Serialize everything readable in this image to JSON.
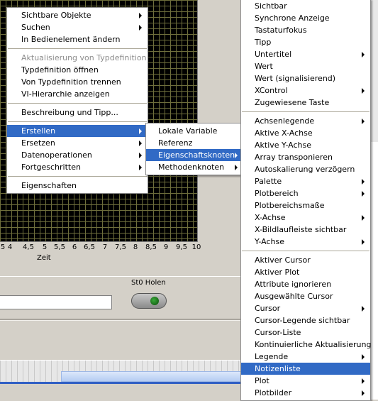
{
  "plot": {
    "x_ticks": [
      "5",
      "4",
      "4,5",
      "5",
      "5,5",
      "6",
      "6,5",
      "7",
      "7,5",
      "8",
      "8,5",
      "9",
      "9,5",
      "10"
    ],
    "x_label": "Zeit"
  },
  "button": {
    "label": "St0 Holen"
  },
  "menu_main": {
    "items": [
      {
        "label": "Sichtbare Objekte",
        "submenu": true
      },
      {
        "label": "Suchen",
        "submenu": true
      },
      {
        "label": "In Bedienelement ändern"
      },
      {
        "sep": true
      },
      {
        "label": "Aktualisierung von Typdefinition",
        "disabled": true
      },
      {
        "label": "Typdefinition öffnen"
      },
      {
        "label": "Von Typdefinition trennen"
      },
      {
        "label": "VI-Hierarchie anzeigen"
      },
      {
        "sep": true
      },
      {
        "label": "Beschreibung und Tipp..."
      },
      {
        "sep": true
      },
      {
        "label": "Erstellen",
        "submenu": true,
        "highlighted": true
      },
      {
        "label": "Ersetzen",
        "submenu": true
      },
      {
        "label": "Datenoperationen",
        "submenu": true
      },
      {
        "label": "Fortgeschritten",
        "submenu": true
      },
      {
        "sep": true
      },
      {
        "label": "Eigenschaften"
      }
    ]
  },
  "menu_create": {
    "items": [
      {
        "label": "Lokale Variable"
      },
      {
        "label": "Referenz"
      },
      {
        "label": "Eigenschaftsknoten",
        "submenu": true,
        "highlighted": true
      },
      {
        "label": "Methodenknoten",
        "submenu": true
      }
    ]
  },
  "menu_props": {
    "items": [
      {
        "label": "Sichtbar"
      },
      {
        "label": "Synchrone Anzeige"
      },
      {
        "label": "Tastaturfokus"
      },
      {
        "label": "Tipp"
      },
      {
        "label": "Untertitel",
        "submenu": true
      },
      {
        "label": "Wert"
      },
      {
        "label": "Wert (signalisierend)"
      },
      {
        "label": "XControl",
        "submenu": true
      },
      {
        "label": "Zugewiesene Taste"
      },
      {
        "sep": true
      },
      {
        "label": "Achsenlegende",
        "submenu": true
      },
      {
        "label": "Aktive X-Achse"
      },
      {
        "label": "Aktive Y-Achse"
      },
      {
        "label": "Array transponieren"
      },
      {
        "label": "Autoskalierung verzögern"
      },
      {
        "label": "Palette",
        "submenu": true
      },
      {
        "label": "Plotbereich",
        "submenu": true
      },
      {
        "label": "Plotbereichsmaße"
      },
      {
        "label": "X-Achse",
        "submenu": true
      },
      {
        "label": "X-Bildlaufleiste sichtbar"
      },
      {
        "label": "Y-Achse",
        "submenu": true
      },
      {
        "sep": true
      },
      {
        "label": "Aktiver Cursor"
      },
      {
        "label": "Aktiver Plot"
      },
      {
        "label": "Attribute ignorieren"
      },
      {
        "label": "Ausgewählte Cursor"
      },
      {
        "label": "Cursor",
        "submenu": true
      },
      {
        "label": "Cursor-Legende sichtbar"
      },
      {
        "label": "Cursor-Liste"
      },
      {
        "label": "Kontinuierliche Aktualisierung"
      },
      {
        "label": "Legende",
        "submenu": true
      },
      {
        "label": "Notizenliste",
        "highlighted": true
      },
      {
        "label": "Plot",
        "submenu": true
      },
      {
        "label": "Plotbilder",
        "submenu": true
      }
    ]
  }
}
